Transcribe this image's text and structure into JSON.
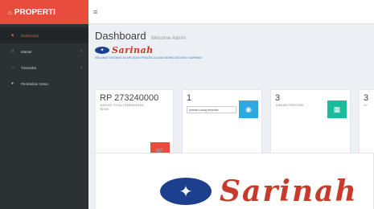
{
  "brand": {
    "title": "PROPERTI",
    "icon": "home-icon"
  },
  "sidebar": {
    "items": [
      {
        "label": "Dashboard",
        "icon": "dashboard-icon",
        "active": true
      },
      {
        "label": "Master",
        "icon": "folder-icon",
        "has_children": true
      },
      {
        "label": "Transaksi",
        "icon": "transaction-icon",
        "has_children": true
      },
      {
        "label": "Pembelian Sewa",
        "icon": "cart-icon"
      }
    ]
  },
  "header": {
    "title": "Dashboard",
    "subtitle": "Welcome Admin"
  },
  "company": {
    "name": "Sarinah",
    "welcome": "SELAMAT DATANG DI APLIKASI PENGELOLAAN SEWA GEDUNG SARINAH"
  },
  "cards": {
    "revenue": {
      "value": "RP 273240000",
      "label": "JUMLAH TOTAL PEMBAYARAN SEWA"
    },
    "units": {
      "value": "1",
      "input_value": "jumlah ruang tersedia"
    },
    "tenants": {
      "value": "3",
      "label": "JUMLAH PENYEWA"
    },
    "fourth": {
      "value": "3",
      "label": "JU"
    }
  },
  "colors": {
    "brand": "#e74c3c",
    "sidebar": "#2c3134",
    "blue": "#2fa8e0",
    "green": "#1abc9c"
  }
}
